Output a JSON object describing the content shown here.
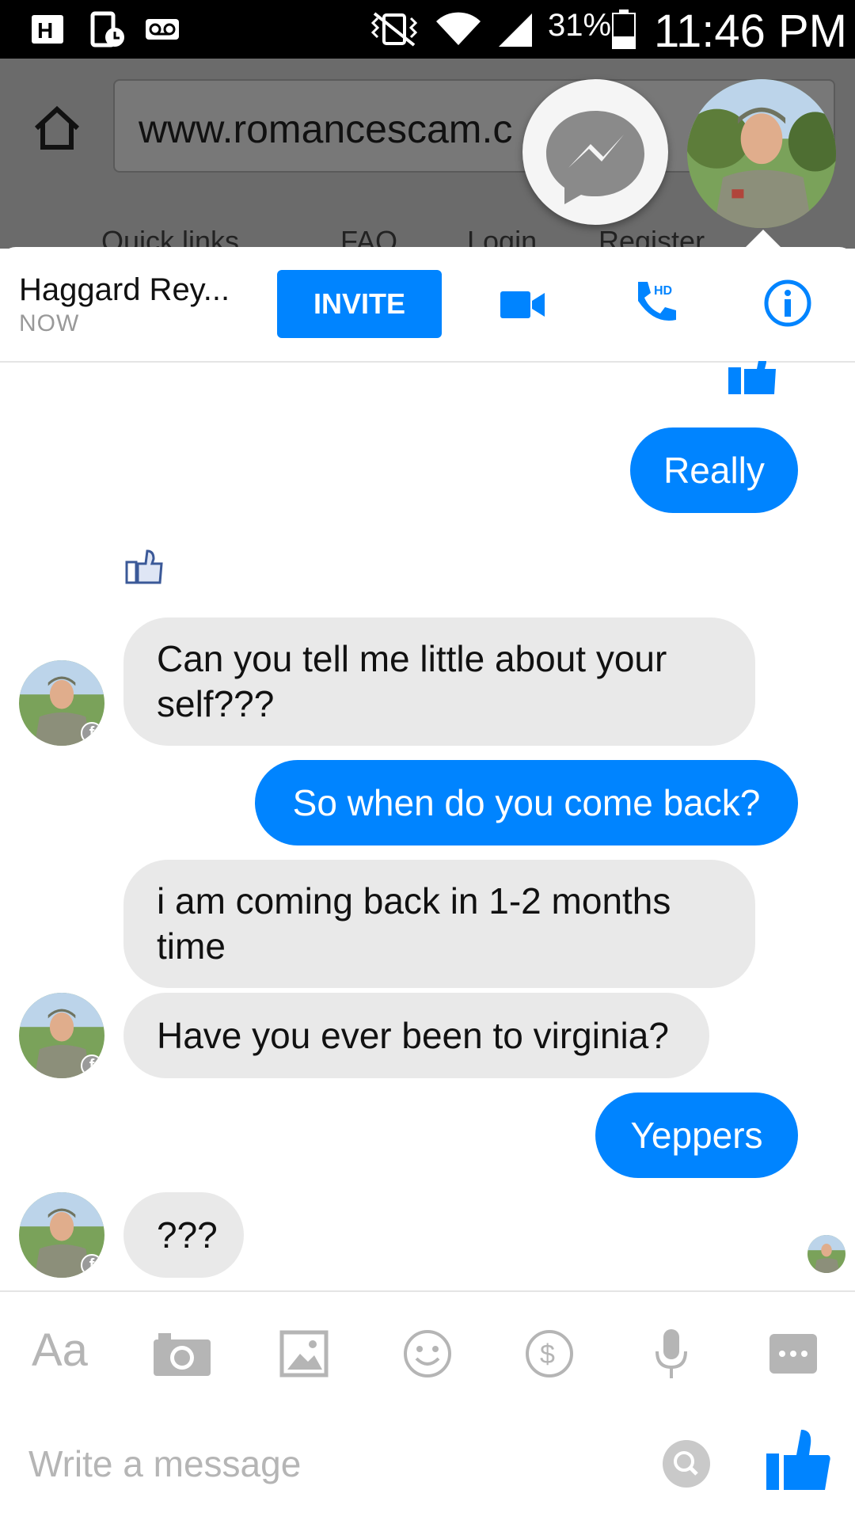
{
  "status_bar": {
    "battery": "31%",
    "time": "11:46 PM",
    "icons": [
      "h-plus-icon",
      "phone-clock-icon",
      "voicemail-icon",
      "vibrate-icon",
      "wifi-icon",
      "signal-icon",
      "battery-icon"
    ]
  },
  "browser": {
    "url": "www.romancescam.c",
    "quick_links": [
      "Quick links",
      "FAQ",
      "Login",
      "Register"
    ]
  },
  "chat": {
    "contact_name": "Haggard Rey...",
    "presence": "NOW",
    "invite_label": "INVITE",
    "accent": "#0084ff"
  },
  "messages": [
    {
      "from": "me",
      "text": "Really"
    },
    {
      "from": "them",
      "text": "Can you tell me little about your self???"
    },
    {
      "from": "me",
      "text": "So when do you come back?"
    },
    {
      "from": "them",
      "text": "i am coming back in 1-2 months time"
    },
    {
      "from": "them",
      "text": "Have you ever been to virginia?"
    },
    {
      "from": "me",
      "text": "Yeppers"
    },
    {
      "from": "them",
      "text": "???"
    }
  ],
  "composer": {
    "aa_label": "Aa",
    "placeholder": "Write a message"
  }
}
